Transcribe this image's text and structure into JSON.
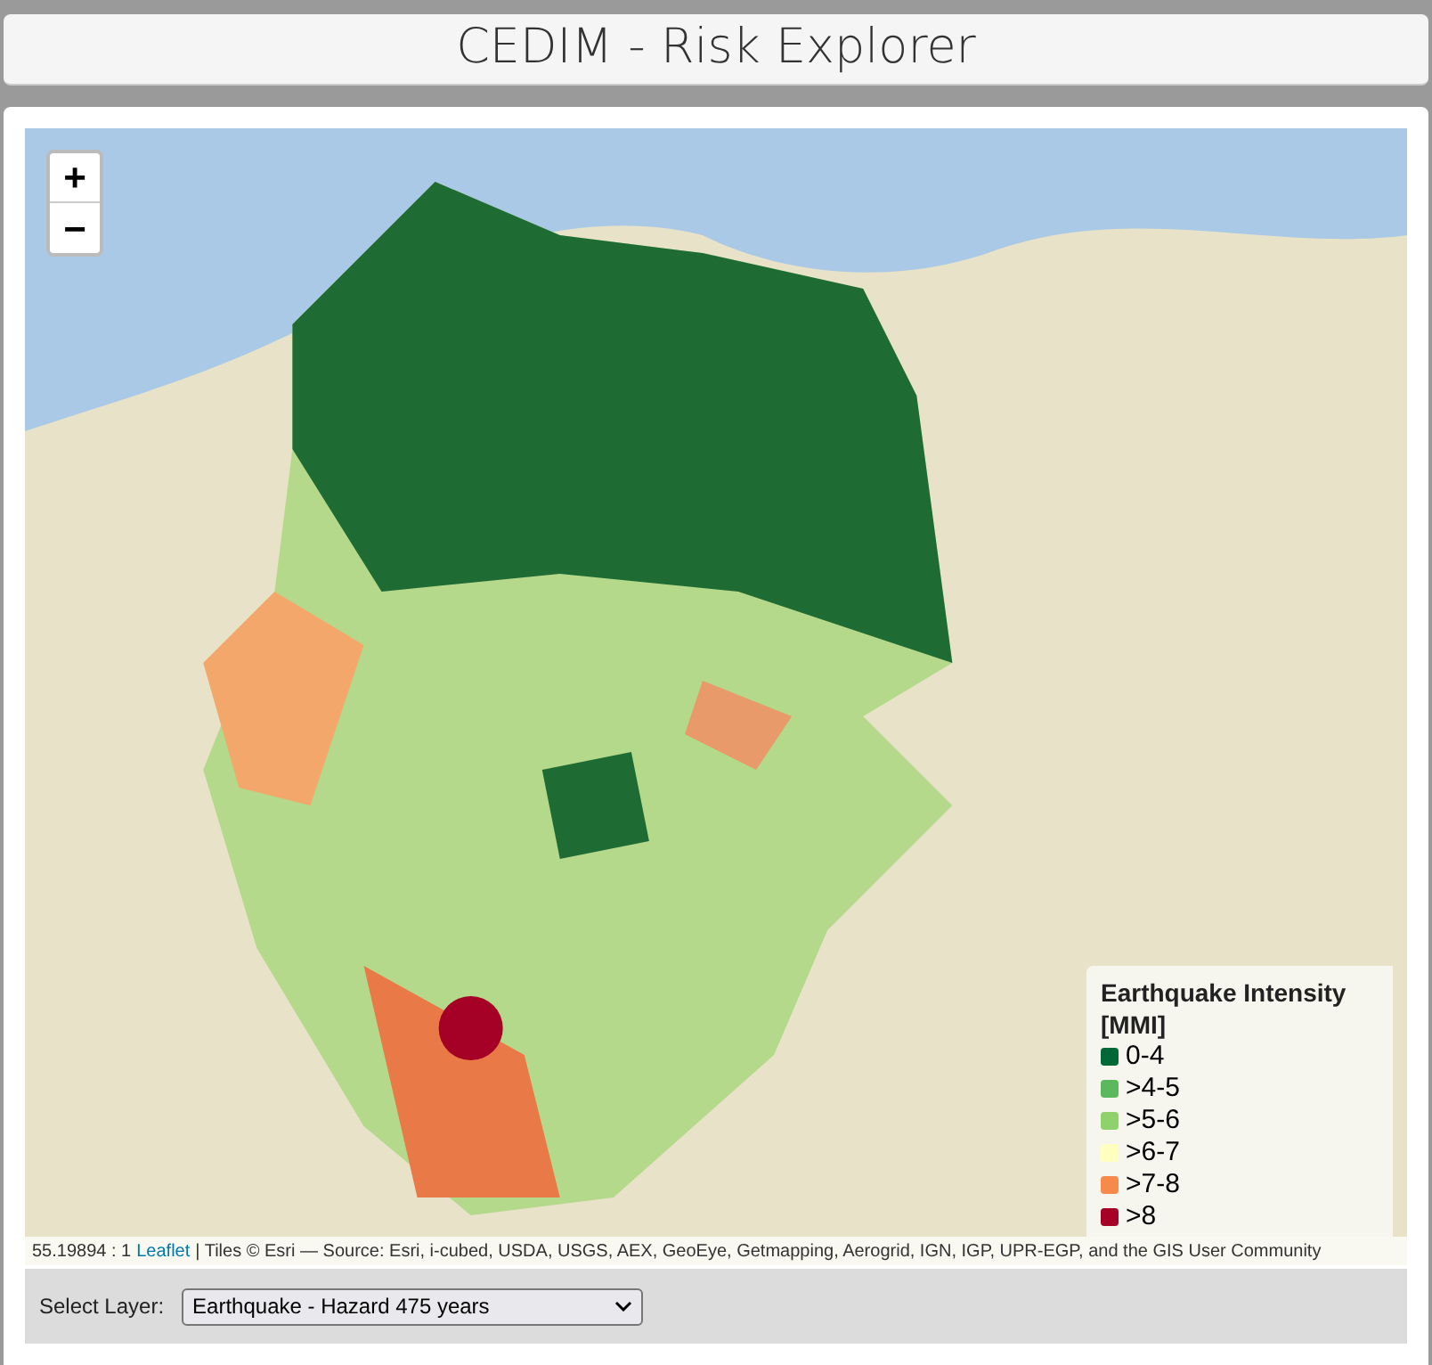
{
  "header": {
    "title": "CEDIM - Risk Explorer"
  },
  "map": {
    "zoom_controls": [
      {
        "kind": "in",
        "label": "+"
      },
      {
        "kind": "out",
        "label": "−"
      }
    ],
    "legend": {
      "title": "Earthquake Intensity [MMI]",
      "items": [
        {
          "label": "0-4",
          "color": "#006837"
        },
        {
          "label": ">4-5",
          "color": "#5cb85c"
        },
        {
          "label": ">5-6",
          "color": "#8fd16a"
        },
        {
          "label": ">6-7",
          "color": "#ffffbf"
        },
        {
          "label": ">7-8",
          "color": "#f58a4b"
        },
        {
          "label": ">8",
          "color": "#a50026"
        }
      ]
    },
    "scale": "55.19894 : 1",
    "attribution_link": "Leaflet",
    "attribution": "| Tiles © Esri — Source: Esri, i-cubed, USDA, USGS, AEX, GeoEye, Getmapping, Aerogrid, IGN, IGP, UPR-EGP, and the GIS User Community"
  },
  "layer_select": {
    "label": "Select Layer:",
    "value": "Earthquake - Hazard 475 years"
  }
}
